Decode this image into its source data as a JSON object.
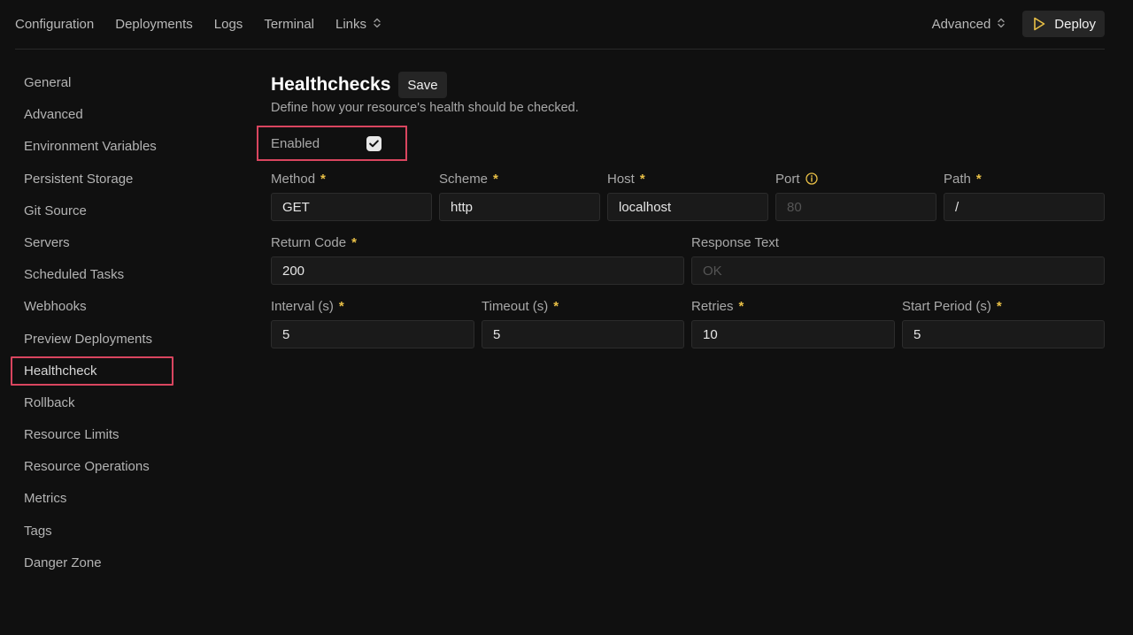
{
  "topnav": {
    "items": [
      {
        "label": "Configuration"
      },
      {
        "label": "Deployments"
      },
      {
        "label": "Logs"
      },
      {
        "label": "Terminal"
      },
      {
        "label": "Links"
      }
    ],
    "advanced_label": "Advanced",
    "deploy_label": "Deploy"
  },
  "sidebar": {
    "items": [
      {
        "label": "General"
      },
      {
        "label": "Advanced"
      },
      {
        "label": "Environment Variables"
      },
      {
        "label": "Persistent Storage"
      },
      {
        "label": "Git Source"
      },
      {
        "label": "Servers"
      },
      {
        "label": "Scheduled Tasks"
      },
      {
        "label": "Webhooks"
      },
      {
        "label": "Preview Deployments"
      },
      {
        "label": "Healthcheck"
      },
      {
        "label": "Rollback"
      },
      {
        "label": "Resource Limits"
      },
      {
        "label": "Resource Operations"
      },
      {
        "label": "Metrics"
      },
      {
        "label": "Tags"
      },
      {
        "label": "Danger Zone"
      }
    ],
    "active": "Healthcheck"
  },
  "main": {
    "title": "Healthchecks",
    "save_label": "Save",
    "subtitle": "Define how your resource's health should be checked.",
    "enabled_label": "Enabled",
    "enabled_checked": true,
    "fields": {
      "method": {
        "label": "Method",
        "value": "GET"
      },
      "scheme": {
        "label": "Scheme",
        "value": "http"
      },
      "host": {
        "label": "Host",
        "value": "localhost"
      },
      "port": {
        "label": "Port",
        "placeholder": "80"
      },
      "path": {
        "label": "Path",
        "value": "/"
      },
      "return_code": {
        "label": "Return Code",
        "value": "200"
      },
      "response_text": {
        "label": "Response Text",
        "placeholder": "OK"
      },
      "interval": {
        "label": "Interval (s)",
        "value": "5"
      },
      "timeout": {
        "label": "Timeout (s)",
        "value": "5"
      },
      "retries": {
        "label": "Retries",
        "value": "10"
      },
      "start_period": {
        "label": "Start Period (s)",
        "value": "5"
      }
    },
    "required_marker": "*"
  },
  "colors": {
    "background": "#101010",
    "highlight": "#d9455f",
    "required": "#e9c046",
    "deploy_icon": "#e9c046"
  },
  "icons": {
    "links_chevron": "chevron-up-down-icon",
    "advanced_chevron": "chevron-up-down-icon",
    "deploy": "play-icon",
    "port_info": "info-icon",
    "checkbox": "check-icon"
  }
}
